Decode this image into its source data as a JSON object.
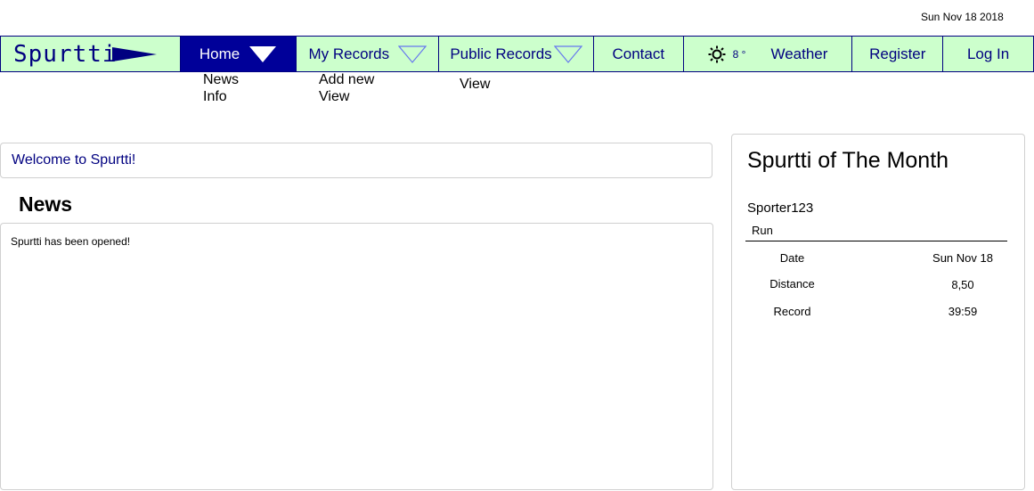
{
  "header": {
    "date": "Sun Nov 18 2018"
  },
  "nav": {
    "logo": "Spurtti",
    "home": "Home",
    "my_records": "My Records",
    "public_records": "Public Records",
    "contact": "Contact",
    "weather_temp": "8 °",
    "weather": "Weather",
    "register": "Register",
    "login": "Log In"
  },
  "submenus": {
    "home": [
      "News",
      "Info"
    ],
    "my_records": [
      "Add new",
      "View"
    ],
    "public_records": [
      "View"
    ]
  },
  "main": {
    "welcome": "Welcome to Spurtti!",
    "news_title": "News",
    "news_text": "Spurtti has been opened!"
  },
  "sidebar": {
    "title": "Spurtti of The Month",
    "user": "Sporter123",
    "sport": "Run",
    "stats": [
      {
        "label": "Date",
        "value": "Sun Nov 18"
      },
      {
        "label": "Distance",
        "value": "8,50"
      },
      {
        "label": "Record",
        "value": "39:59"
      }
    ]
  },
  "colors": {
    "nav_bg": "#ccffcc",
    "nav_text": "#000080",
    "active_bg": "#000099"
  },
  "icons": {
    "weather": "sun-icon",
    "dropdown": "triangle-down-icon"
  }
}
